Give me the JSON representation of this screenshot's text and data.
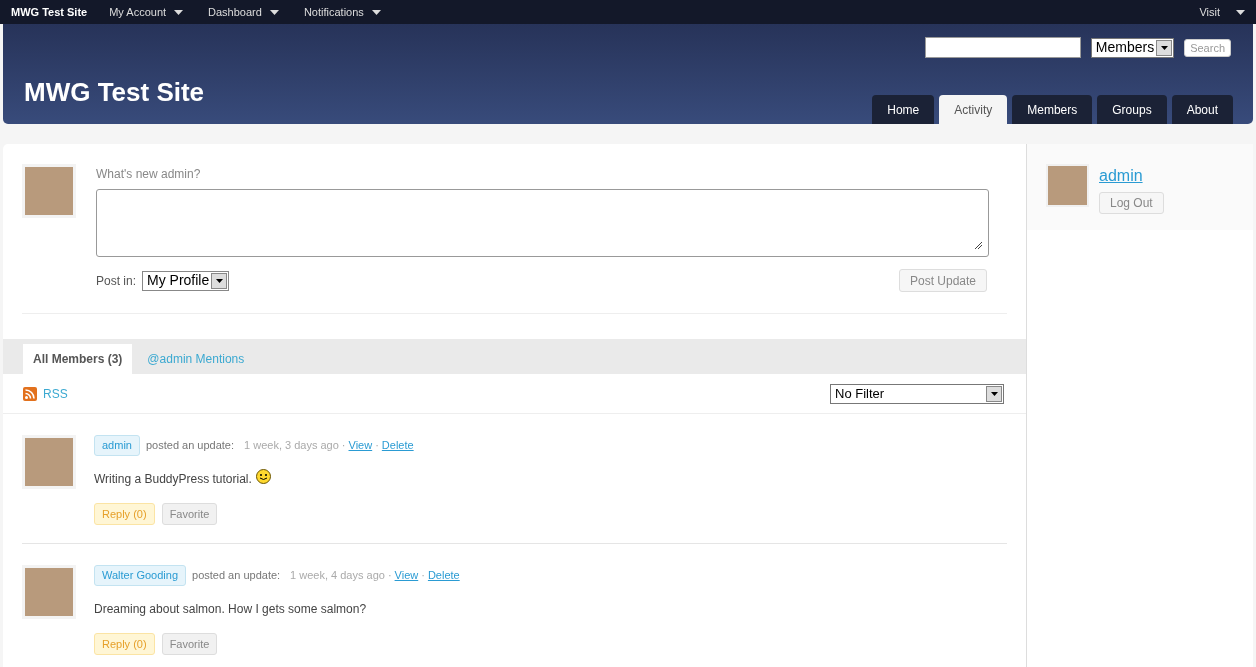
{
  "admin_bar": {
    "site": "MWG Test Site",
    "menus": [
      "My Account",
      "Dashboard",
      "Notifications"
    ],
    "visit": "Visit"
  },
  "header": {
    "title": "MWG Test Site",
    "search": {
      "scope": "Members",
      "button": "Search"
    },
    "nav": [
      {
        "label": "Home",
        "selected": false
      },
      {
        "label": "Activity",
        "selected": true
      },
      {
        "label": "Members",
        "selected": false
      },
      {
        "label": "Groups",
        "selected": false
      },
      {
        "label": "About",
        "selected": false
      }
    ]
  },
  "post_form": {
    "prompt": "What's new admin?",
    "post_in_label": "Post in:",
    "post_in_value": "My Profile",
    "button": "Post Update"
  },
  "activity_tabs": [
    {
      "label": "All Members (3)",
      "selected": true
    },
    {
      "label": "@admin Mentions",
      "selected": false
    }
  ],
  "rss": "RSS",
  "filter": "No Filter",
  "activities": [
    {
      "user": "admin",
      "action": "posted an update:",
      "time": "1 week, 3 days ago",
      "separator": "·",
      "view": "View",
      "delete": "Delete",
      "text": "Writing a BuddyPress tutorial.",
      "emoticon": true,
      "reply": "Reply (0)",
      "favorite": "Favorite"
    },
    {
      "user": "Walter Gooding",
      "action": "posted an update:",
      "time": "1 week, 4 days ago",
      "separator": "·",
      "view": "View",
      "delete": "Delete",
      "text": "Dreaming about salmon. How I gets some salmon?",
      "emoticon": false,
      "reply": "Reply (0)",
      "favorite": "Favorite"
    }
  ],
  "sidebar": {
    "user": "admin",
    "logout": "Log Out"
  }
}
